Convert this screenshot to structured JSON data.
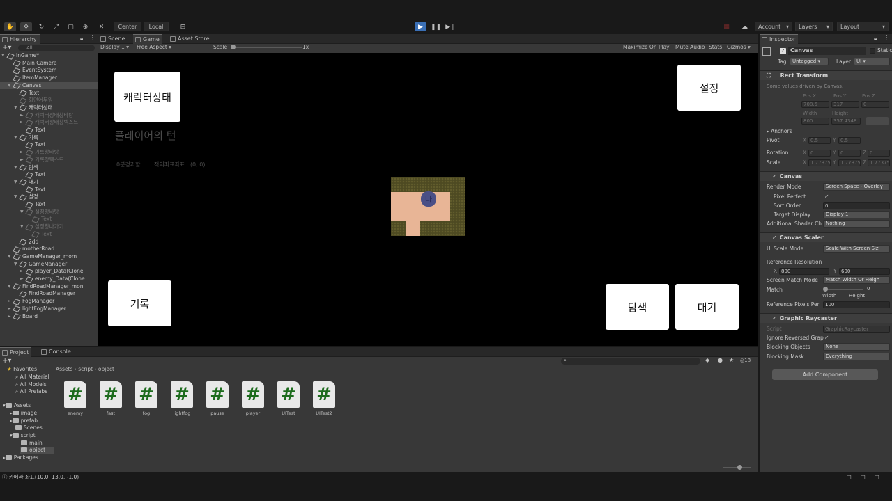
{
  "toolbar": {
    "pivot": "Center",
    "space": "Local",
    "account": "Account",
    "layers": "Layers",
    "layout": "Layout"
  },
  "hierarchy": {
    "tab": "Hierarchy",
    "search": "All",
    "rows": [
      {
        "label": "InGame*",
        "depth": 0,
        "arrow": "▼",
        "scene": true
      },
      {
        "label": "Main Camera",
        "depth": 1
      },
      {
        "label": "EventSystem",
        "depth": 1
      },
      {
        "label": "ItemManager",
        "depth": 1
      },
      {
        "label": "Canvas",
        "depth": 1,
        "arrow": "▼",
        "selected": true
      },
      {
        "label": "Text",
        "depth": 2
      },
      {
        "label": "화면어두워",
        "depth": 2,
        "dim": true
      },
      {
        "label": "캐릭터상태",
        "depth": 2,
        "arrow": "▼"
      },
      {
        "label": "캐릭터상태창바탕",
        "depth": 3,
        "arrow": "►",
        "dim": true
      },
      {
        "label": "캐릭터상태창텍스트",
        "depth": 3,
        "arrow": "►",
        "dim": true
      },
      {
        "label": "Text",
        "depth": 3
      },
      {
        "label": "기록",
        "depth": 2,
        "arrow": "▼"
      },
      {
        "label": "Text",
        "depth": 3
      },
      {
        "label": "기록창바탕",
        "depth": 3,
        "arrow": "►",
        "dim": true
      },
      {
        "label": "기록창텍스트",
        "depth": 3,
        "arrow": "►",
        "dim": true
      },
      {
        "label": "탐색",
        "depth": 2,
        "arrow": "▼"
      },
      {
        "label": "Text",
        "depth": 3
      },
      {
        "label": "대기",
        "depth": 2,
        "arrow": "▼"
      },
      {
        "label": "Text",
        "depth": 3
      },
      {
        "label": "설정",
        "depth": 2,
        "arrow": "▼"
      },
      {
        "label": "Text",
        "depth": 3
      },
      {
        "label": "설정창바탕",
        "depth": 3,
        "arrow": "▼",
        "dim": true
      },
      {
        "label": "Text",
        "depth": 4,
        "dim": true
      },
      {
        "label": "설정창나가기",
        "depth": 3,
        "arrow": "▼",
        "dim": true
      },
      {
        "label": "Text",
        "depth": 4,
        "dim": true
      },
      {
        "label": "2dd",
        "depth": 2
      },
      {
        "label": "motherRoad",
        "depth": 1
      },
      {
        "label": "GameManager_mom",
        "depth": 1,
        "arrow": "▼"
      },
      {
        "label": "GameManager",
        "depth": 2,
        "arrow": "▼"
      },
      {
        "label": "player_Data(Clone",
        "depth": 3,
        "arrow": "►"
      },
      {
        "label": "enemy_Data(Clone",
        "depth": 3,
        "arrow": "►"
      },
      {
        "label": "FindRoadManager_mon",
        "depth": 1,
        "arrow": "▼"
      },
      {
        "label": "FindRoadManager",
        "depth": 2
      },
      {
        "label": "FogManager",
        "depth": 1,
        "arrow": "►"
      },
      {
        "label": "lightFogManager",
        "depth": 1,
        "arrow": "►"
      },
      {
        "label": "Board",
        "depth": 1,
        "arrow": "►"
      }
    ]
  },
  "game": {
    "tabs": [
      "Scene",
      "Game",
      "Asset Store"
    ],
    "display": "Display 1",
    "aspect": "Free Aspect",
    "scale_label": "Scale",
    "scale_value": "1x",
    "maximize": "Maximize On Play",
    "mute": "Mute Audio",
    "stats": "Stats",
    "gizmos": "Gizmos",
    "btn_status": "캐릭터상태",
    "btn_settings": "설정",
    "btn_record": "기록",
    "btn_explore": "탐색",
    "btn_wait": "대기",
    "turn_text": "플레이어의 턴",
    "info_left": "0분경과함",
    "info_right": "적의좌표좌표 : (0, 0)",
    "player_label": "나"
  },
  "inspector": {
    "tab": "Inspector",
    "object_name": "Canvas",
    "static": "Static",
    "tag_label": "Tag",
    "tag_value": "Untagged",
    "layer_label": "Layer",
    "layer_value": "UI",
    "rect": {
      "title": "Rect Transform",
      "note": "Some values driven by Canvas.",
      "posx_label": "Pos X",
      "posy_label": "Pos Y",
      "posz_label": "Pos Z",
      "posx": "708.5",
      "posy": "317",
      "posz": "0",
      "width_label": "Width",
      "height_label": "Height",
      "width": "800",
      "height": "357.4348",
      "anchors": "Anchors",
      "pivot": "Pivot",
      "pivot_x": "0.5",
      "pivot_y": "0.5",
      "rotation": "Rotation",
      "rot_x": "0",
      "rot_y": "0",
      "rot_z": "0",
      "scale": "Scale",
      "sc_x": "1.77375",
      "sc_y": "1.77375",
      "sc_z": "1.77375",
      "x": "X",
      "y": "Y",
      "z": "Z"
    },
    "canvas": {
      "title": "Canvas",
      "render_mode_label": "Render Mode",
      "render_mode": "Screen Space - Overlay",
      "pixel_perfect": "Pixel Perfect",
      "sort_order_label": "Sort Order",
      "sort_order": "0",
      "target_display_label": "Target Display",
      "target_display": "Display 1",
      "shader_label": "Additional Shader Ch",
      "shader": "Nothing"
    },
    "scaler": {
      "title": "Canvas Scaler",
      "ui_scale_label": "UI Scale Mode",
      "ui_scale": "Scale With Screen Siz",
      "ref_res": "Reference Resolution",
      "ref_x": "800",
      "ref_y": "600",
      "match_mode_label": "Screen Match Mode",
      "match_mode": "Match Width Or Heigh",
      "match_label": "Match",
      "match_value": "0",
      "match_width": "Width",
      "match_height": "Height",
      "ppu_label": "Reference Pixels Per",
      "ppu": "100"
    },
    "raycaster": {
      "title": "Graphic Raycaster",
      "script_label": "Script",
      "script": "GraphicRaycaster",
      "ignore_label": "Ignore Reversed Grap",
      "blocking_label": "Blocking Objects",
      "blocking": "None",
      "mask_label": "Blocking Mask",
      "mask": "Everything"
    },
    "add_component": "Add Component"
  },
  "project": {
    "tabs": [
      "Project",
      "Console"
    ],
    "breadcrumb": [
      "Assets",
      "script",
      "object"
    ],
    "count": "18",
    "favorites": "Favorites",
    "fav_items": [
      "All Material",
      "All Models",
      "All Prefabs"
    ],
    "assets_label": "Assets",
    "asset_folders": [
      "image",
      "prefab",
      "Scenes",
      "script",
      "main",
      "object"
    ],
    "packages": "Packages",
    "files": [
      "enemy",
      "fast",
      "fog",
      "lightfog",
      "pause",
      "player",
      "UITest",
      "UITest2"
    ]
  },
  "status_bar": "카메라 좌표(10.0, 13.0, -1.0)"
}
